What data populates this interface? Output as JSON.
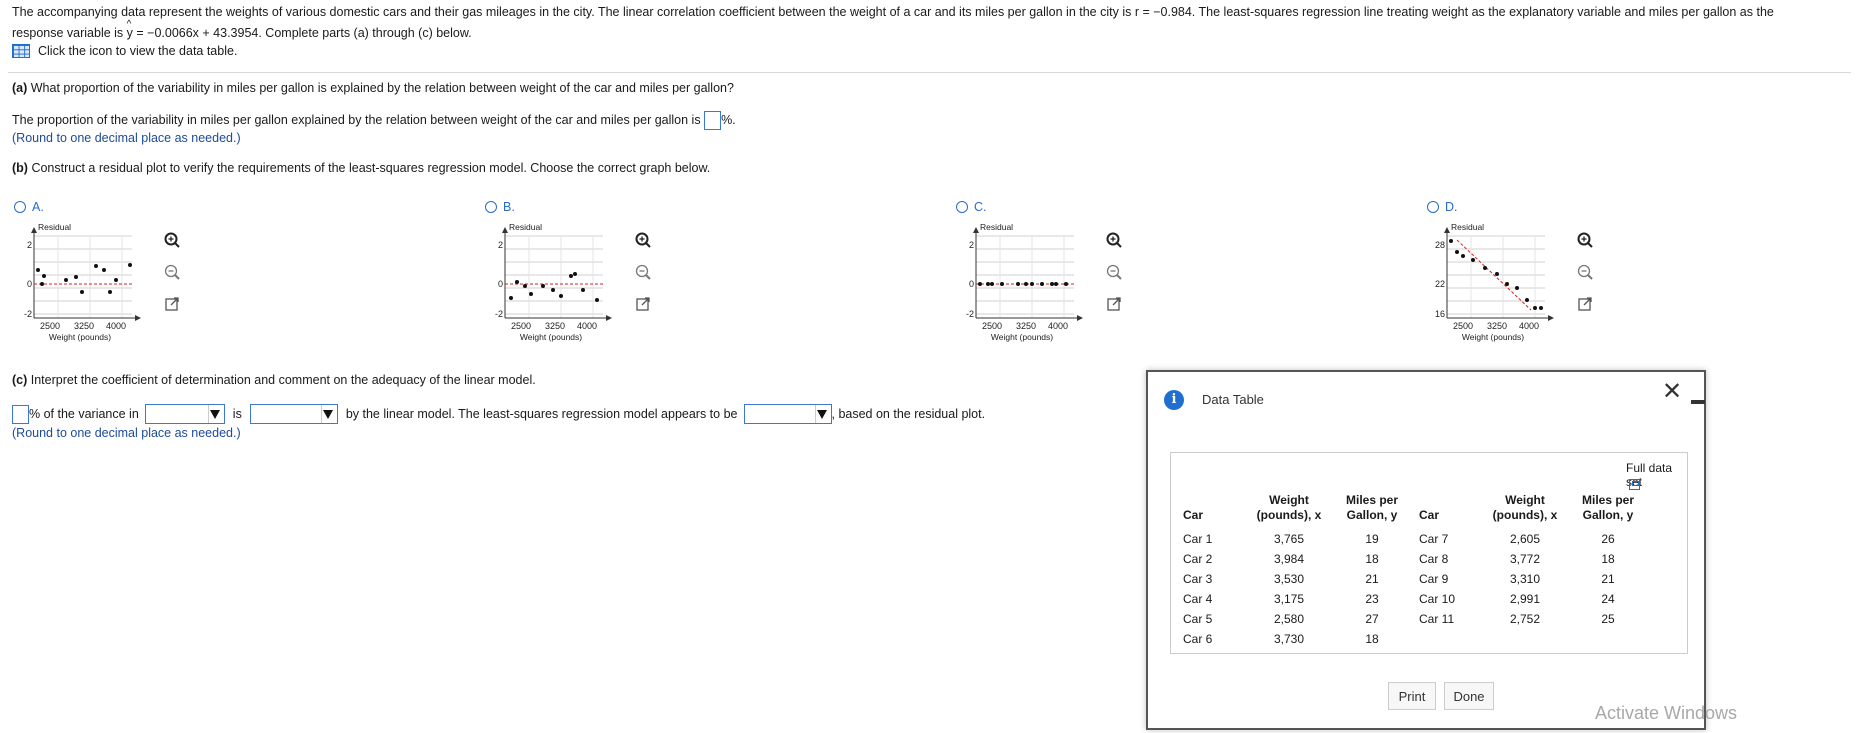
{
  "intro": {
    "line1": "The accompanying data represent the weights of various domestic cars and their gas mileages in the city. The linear correlation coefficient between the weight of a car and its miles per gallon in the city is r = −0.984. The least-squares regression line treating weight as the explanatory variable and miles per gallon as the",
    "line2_pre": "response variable is ",
    "yhat": "y",
    "line2_post": " = −0.0066x + 43.3954. Complete parts (a) through (c) below.",
    "table_link": "Click the icon to view the data table."
  },
  "part_a": {
    "question_label": "(a)",
    "question": " What proportion of the variability in miles per gallon is explained by the relation between weight of the car and miles per gallon?",
    "answer_pre": "The proportion of the variability in miles per gallon explained by the relation between weight of the car and miles per gallon is ",
    "answer_post": "%.",
    "hint": "(Round to one decimal place as needed.)"
  },
  "part_b": {
    "question_label": "(b)",
    "question": " Construct a residual plot to verify the requirements of the least-squares regression model. Choose the correct graph below.",
    "options": [
      {
        "label": "A.",
        "ylabel": "Residual",
        "xlabel": "Weight (pounds)",
        "ymax": "2",
        "ymid": "0",
        "ymin": "-2",
        "xticks": [
          "2500",
          "3250",
          "4000"
        ]
      },
      {
        "label": "B.",
        "ylabel": "Residual",
        "xlabel": "Weight (pounds)",
        "ymax": "2",
        "ymid": "0",
        "ymin": "-2",
        "xticks": [
          "2500",
          "3250",
          "4000"
        ]
      },
      {
        "label": "C.",
        "ylabel": "Residual",
        "xlabel": "Weight (pounds)",
        "ymax": "2",
        "ymid": "0",
        "ymin": "-2",
        "xticks": [
          "2500",
          "3250",
          "4000"
        ]
      },
      {
        "label": "D.",
        "ylabel": "Residual",
        "xlabel": "Weight (pounds)",
        "ymax": "28",
        "ymid": "22",
        "ymin": "16",
        "xticks": [
          "2500",
          "3250",
          "4000"
        ]
      }
    ]
  },
  "part_c": {
    "question_label": "(c)",
    "question": " Interpret the coefficient of determination and comment on the adequacy of the linear model.",
    "t1": "% of the variance in",
    "t2": "is",
    "t3": "by the linear model. The least-squares regression model appears to be",
    "t4": ", based on the residual plot.",
    "hint": "(Round to one decimal place as needed.)"
  },
  "dialog": {
    "title": "Data Table",
    "full_data_set": "Full data set",
    "headers": {
      "car": "Car",
      "weight1": "Weight",
      "weight2": "(pounds), x",
      "mpg1": "Miles per",
      "mpg2": "Gallon, y"
    },
    "rows": [
      [
        "Car 1",
        "3,765",
        "19",
        "Car 7",
        "2,605",
        "26"
      ],
      [
        "Car 2",
        "3,984",
        "18",
        "Car 8",
        "3,772",
        "18"
      ],
      [
        "Car 3",
        "3,530",
        "21",
        "Car 9",
        "3,310",
        "21"
      ],
      [
        "Car 4",
        "3,175",
        "23",
        "Car 10",
        "2,991",
        "24"
      ],
      [
        "Car 5",
        "2,580",
        "27",
        "Car 11",
        "2,752",
        "25"
      ],
      [
        "Car 6",
        "3,730",
        "18",
        "",
        "",
        ""
      ]
    ],
    "print": "Print",
    "done": "Done"
  },
  "watermark": "Activate Windows",
  "colors": {
    "link": "#1d4a9c",
    "option": "#2b6cc4",
    "accent": "#1f6fd1",
    "regression": "#d42020"
  }
}
